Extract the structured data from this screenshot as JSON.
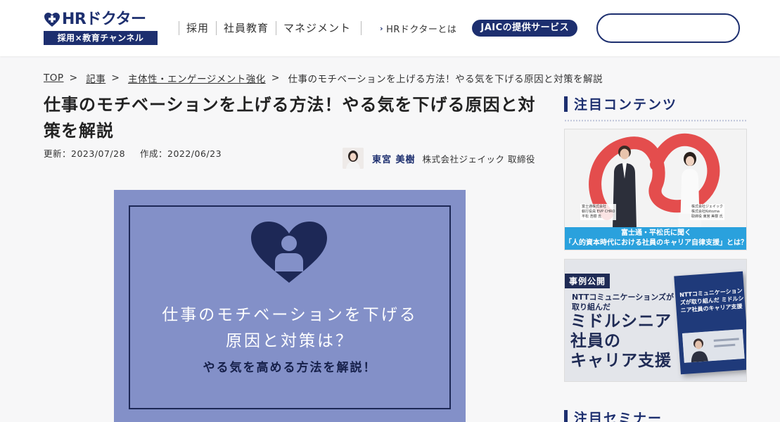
{
  "header": {
    "logo_text": "HRドクター",
    "logo_sub": "採用×教育チャンネル",
    "nav": [
      "採用",
      "社員教育",
      "マネジメント"
    ],
    "about_link": "HRドクターとは",
    "service_button": "JAICの提供サービス",
    "search_placeholder": ""
  },
  "breadcrumb": {
    "items": [
      "TOP",
      "記事",
      "主体性・エンゲージメント強化"
    ],
    "separator": ">",
    "current": "仕事のモチベーションを上げる方法！やる気を下げる原因と対策を解説"
  },
  "article": {
    "title": "仕事のモチベーションを上げる方法！やる気を下げる原因と対策を解説",
    "updated": "更新：2023/07/28",
    "created": "作成：2022/06/23",
    "author_name": "東宮 美樹",
    "author_role": "株式会社ジェイック 取締役",
    "hero": {
      "line1": "仕事のモチベーションを下げる",
      "line2": "原因と対策は？",
      "line3": "やる気を高める方法を解説！"
    }
  },
  "sidebar": {
    "featured_title": "注目コンテンツ",
    "banner1": {
      "tag_left": "富士通株式会社\n執行役員 EVP CHRO\n平松 浩樹 氏",
      "tag_right": "株式会社ジェイック\n株式会社Kotozna\n取締役 東宮 美樹 氏",
      "caption1": "富士通・平松氏に聞く",
      "caption2": "「人的資本時代における社員のキャリア自律支援」とは？"
    },
    "banner2": {
      "badge": "事例公開",
      "sub1": "NTTコミュニケーションズが",
      "sub2": "取り組んだ",
      "big1": "ミドルシニア",
      "big2": "社員の",
      "big3": "キャリア支援",
      "book_title": "NTTコミュニケーションズが取り組んだ ミドルシニア社員のキャリア支援"
    },
    "seminar_title": "注目セミナー"
  },
  "colors": {
    "brand_navy": "#1d2f6f",
    "hero_bg": "#8390c8",
    "caption_blue": "#2aa1dd"
  }
}
